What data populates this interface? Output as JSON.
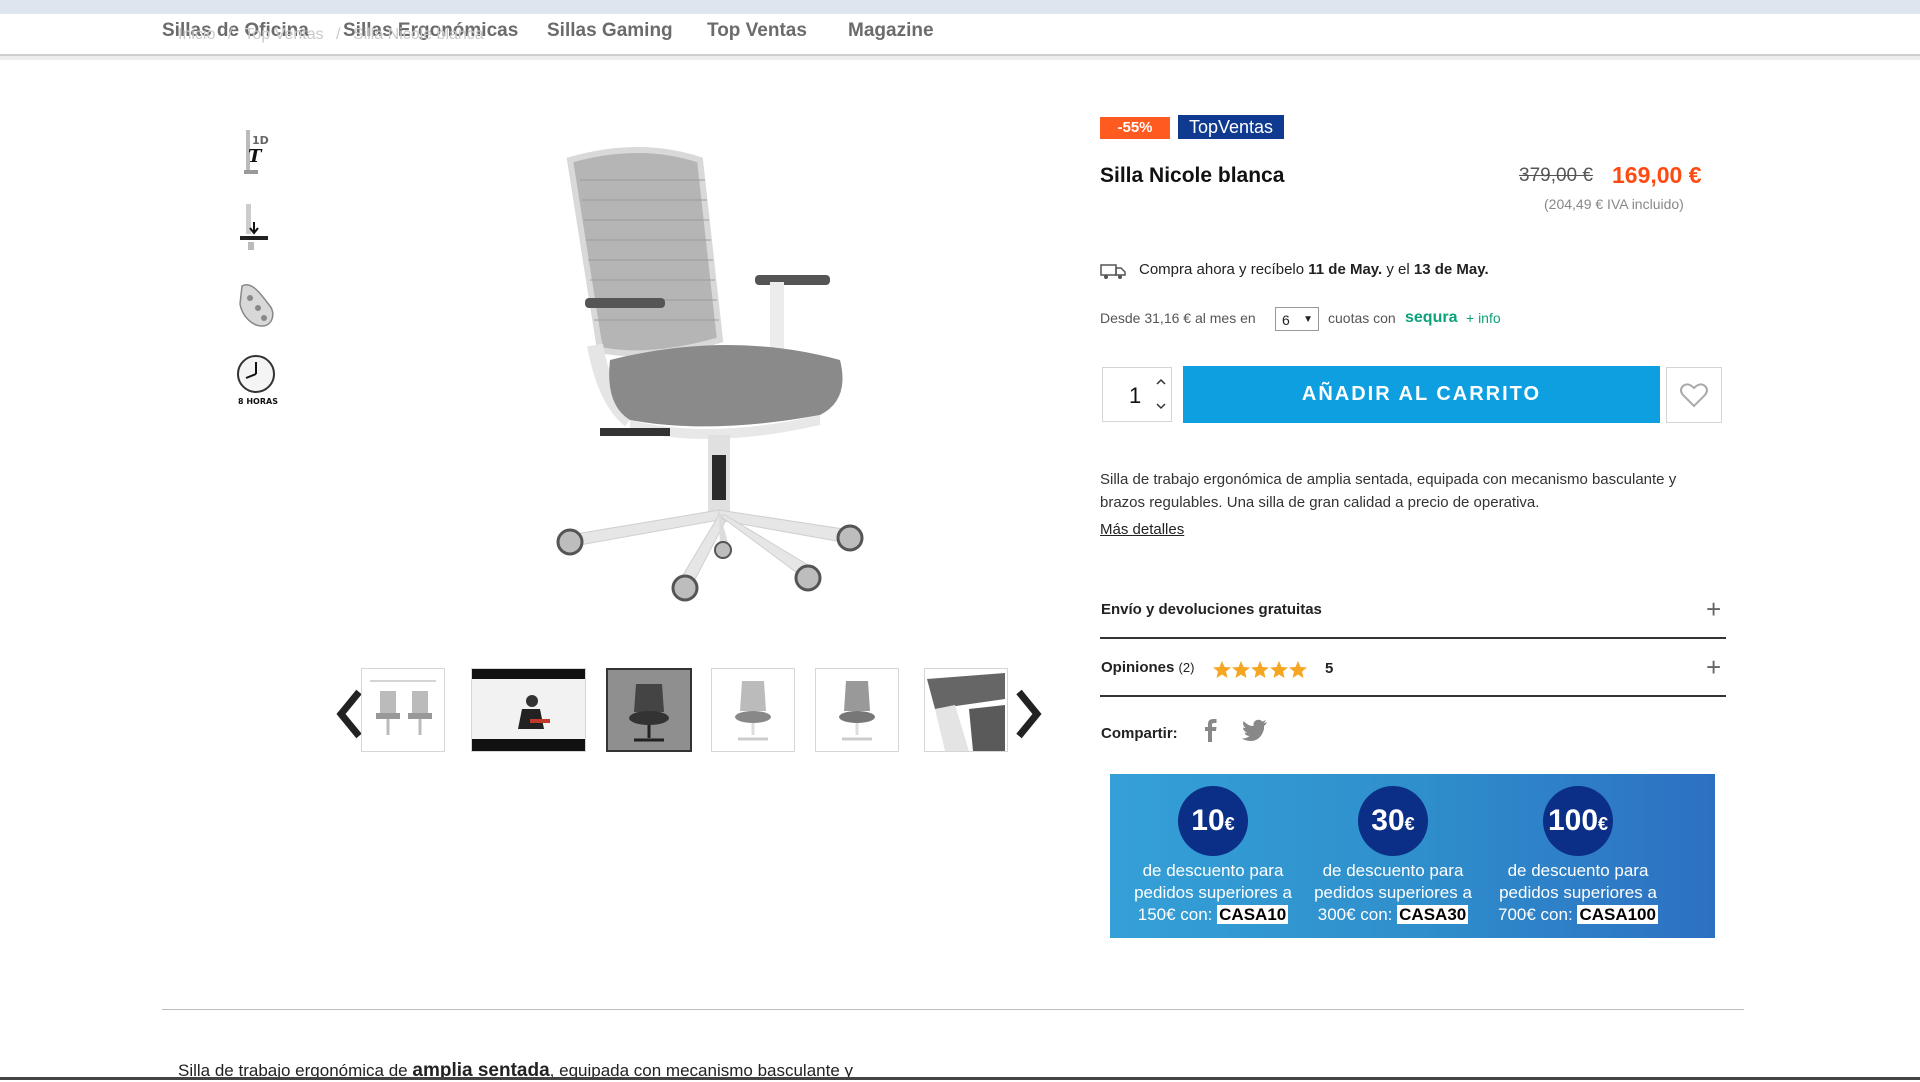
{
  "nav": {
    "items": [
      "Sillas de Oficina",
      "Sillas Ergonómicas",
      "Sillas Gaming",
      "Top Ventas",
      "Magazine"
    ],
    "breadcrumbs": [
      "Inicio",
      "/",
      "Top Ventas",
      "/",
      "Silla Nicole blanca"
    ]
  },
  "features": [
    {
      "icon": "armrest-1d-icon",
      "label": "1D"
    },
    {
      "icon": "height-adjust-icon",
      "label": ""
    },
    {
      "icon": "ergonomic-back-icon",
      "label": ""
    },
    {
      "icon": "clock-8h-icon",
      "label": "8 HORAS"
    }
  ],
  "product": {
    "discount_badge": "-55%",
    "top_badge": "TopVentas",
    "name": "Silla Nicole blanca",
    "old_price": "379,00 €",
    "price": "169,00 €",
    "vat_note": "(204,49 € IVA incluido)",
    "delivery_prefix": "Compra ahora y recíbelo",
    "delivery_date1": "11 de May.",
    "delivery_mid": "y el",
    "delivery_date2": "13 de May.",
    "financing_prefix": "Desde 31,16 € al mes en",
    "installments_selected": "6",
    "financing_suffix": "cuotas con",
    "financing_brand": "sequra",
    "financing_info": "+ info",
    "quantity": "1",
    "add_to_cart": "AÑADIR AL CARRITO",
    "description": "Silla de trabajo ergonómica de amplia sentada, equipada con mecanismo basculante y brazos regulables. Una silla de gran calidad a precio de operativa.",
    "more_details": "Más detalles"
  },
  "accordion": {
    "shipping": "Envío y devoluciones gratuitas",
    "reviews": "Opiniones",
    "reviews_count": "(2)",
    "rating_value": "5",
    "stars": 5
  },
  "share": {
    "label": "Compartir:"
  },
  "promo": [
    {
      "amount": "10",
      "currency": "€",
      "line1": "de descuento para",
      "line2": "pedidos superiores a",
      "line3": "150€ con:",
      "code": "CASA10"
    },
    {
      "amount": "30",
      "currency": "€",
      "line1": "de descuento para",
      "line2": "pedidos superiores a",
      "line3": "300€ con:",
      "code": "CASA30"
    },
    {
      "amount": "100",
      "currency": "€",
      "line1": "de descuento para",
      "line2": "pedidos superiores a",
      "line3": "700€ con:",
      "code": "CASA100"
    }
  ],
  "bottom": {
    "text_pre": "Silla de trabajo ergonómica de",
    "text_bold": "amplia sentada",
    "text_post": ", equipada con mecanismo basculante y"
  },
  "colors": {
    "accent": "#0d9fe0",
    "price": "#ff4b12",
    "discount": "#ff5a1f",
    "badge": "#0f3a8f",
    "sequra": "#0ba27b"
  }
}
